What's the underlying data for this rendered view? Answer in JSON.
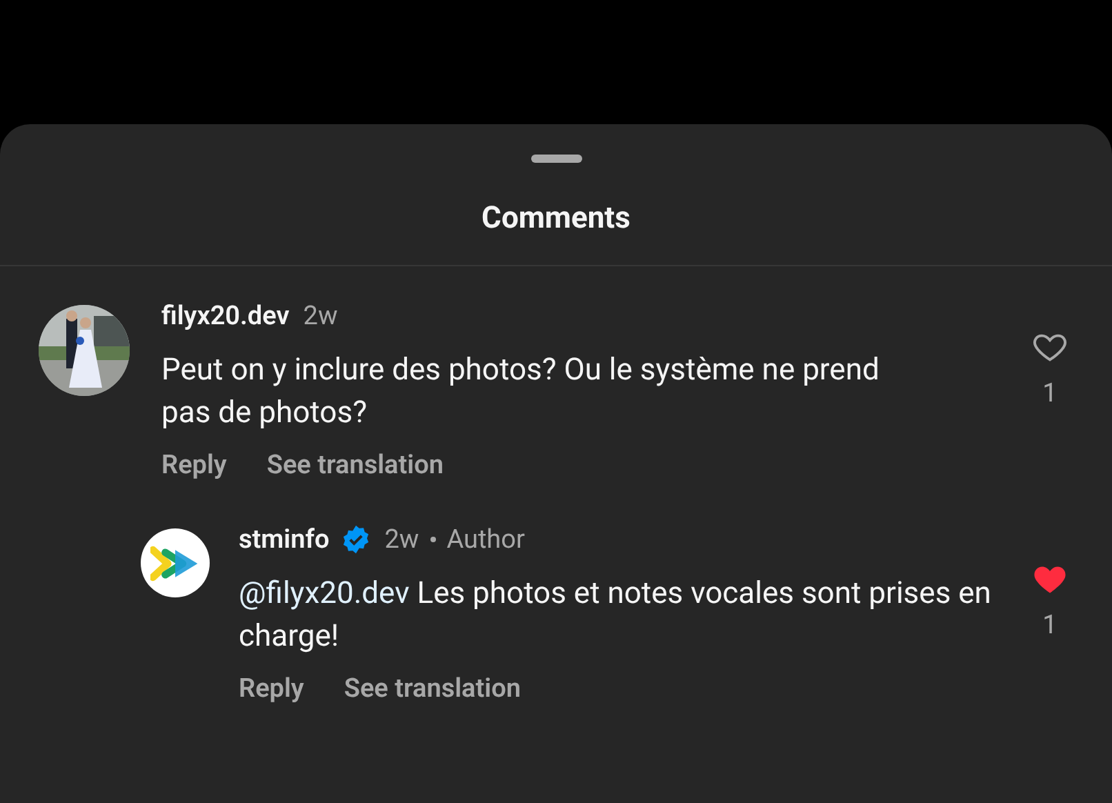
{
  "sheet": {
    "title": "Comments"
  },
  "comments": [
    {
      "kind": "top",
      "username": "filyx20.dev",
      "verified": false,
      "time": "2w",
      "text": "Peut on y inclure des photos? Ou le système ne prend pas de photos?",
      "actions": [
        "Reply",
        "See translation"
      ],
      "liked": false,
      "likes": "1"
    },
    {
      "kind": "reply",
      "avatar": {
        "kind": "logo"
      },
      "username": "stminfo",
      "verified": true,
      "time": "2w",
      "badge": "Author",
      "mention": "@filyx20.dev",
      "text": "Les photos et notes vocales sont prises en charge!",
      "actions": [
        "Reply",
        "See translation"
      ],
      "liked": true,
      "likes": "1"
    }
  ]
}
